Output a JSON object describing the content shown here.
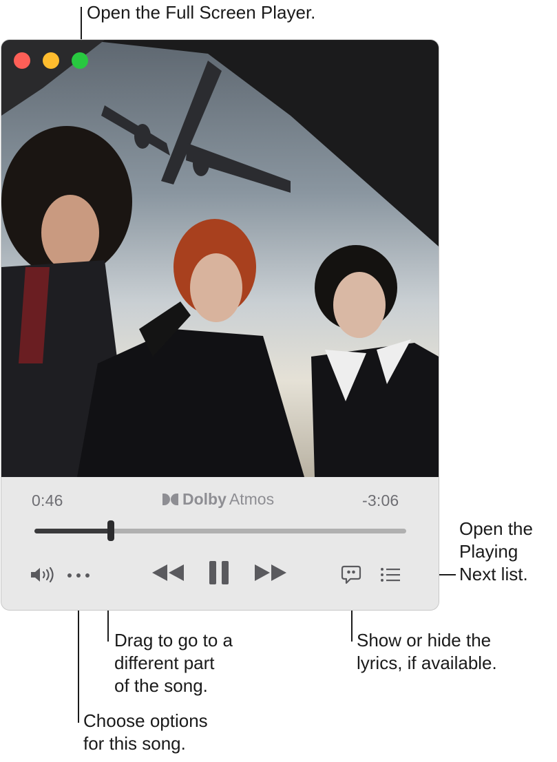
{
  "callouts": {
    "full_screen": "Open the Full Screen Player.",
    "playing_next": "Open the\nPlaying\nNext list.",
    "scrubber": "Drag to go to a\ndifferent part\nof the song.",
    "lyrics": "Show or hide the\nlyrics, if available.",
    "options": "Choose options\nfor this song."
  },
  "player": {
    "elapsed": "0:46",
    "remaining": "-3:06",
    "audio_format": {
      "brand": "Dolby",
      "name": "Atmos"
    },
    "progress": 0.205,
    "album_art": "photo-three-people-airplane"
  },
  "colors": {
    "close": "#fe5f57",
    "minimize": "#febc2e",
    "full_screen": "#28c840",
    "track": "#b0b0b0",
    "track_fill": "#3a3a3c"
  },
  "icons": {
    "volume": "speaker-volume-icon",
    "more": "ellipsis-icon",
    "previous": "rewind-icon",
    "play_pause": "pause-icon",
    "next": "fast-forward-icon",
    "lyrics": "lyrics-quote-icon",
    "queue": "list-icon"
  }
}
